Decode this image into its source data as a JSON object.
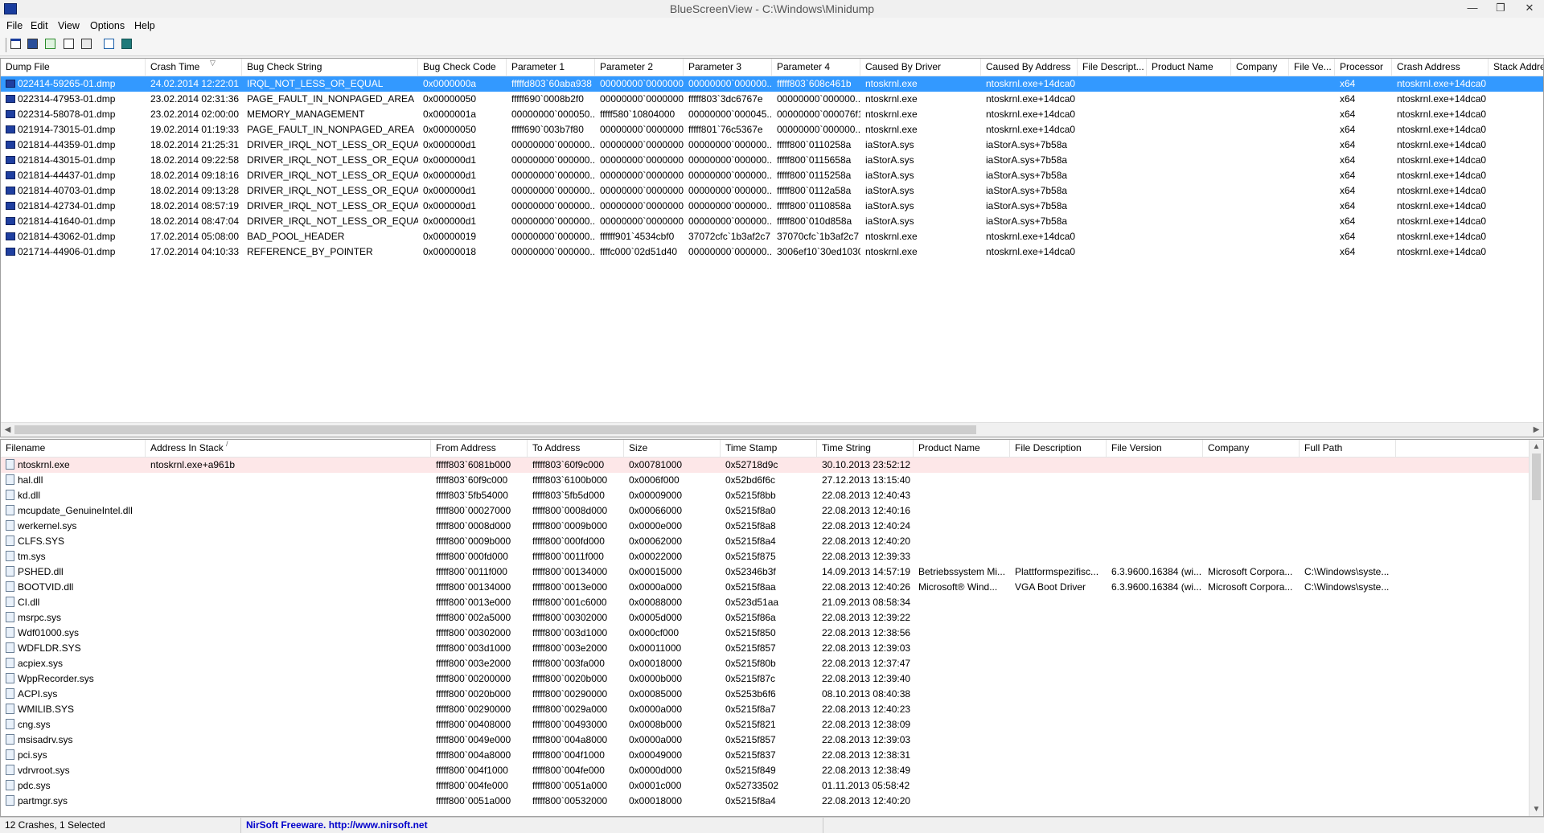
{
  "window": {
    "title": "BlueScreenView  -  C:\\Windows\\Minidump"
  },
  "window_buttons": {
    "minimize": "—",
    "restore": "❐",
    "close": "✕"
  },
  "menu": [
    "File",
    "Edit",
    "View",
    "Options",
    "Help"
  ],
  "toolbar": [
    {
      "name": "properties-icon"
    },
    {
      "name": "save-icon"
    },
    {
      "name": "refresh-icon"
    },
    {
      "name": "copy-icon"
    },
    {
      "name": "advanced-options-icon"
    },
    {
      "name": "find-icon"
    },
    {
      "name": "exit-icon"
    }
  ],
  "crash_table": {
    "columns": [
      "Dump File",
      "Crash Time",
      "Bug Check String",
      "Bug Check Code",
      "Parameter 1",
      "Parameter 2",
      "Parameter 3",
      "Parameter 4",
      "Caused By Driver",
      "Caused By Address",
      "File Descript...",
      "Product Name",
      "Company",
      "File Ve...",
      "Processor",
      "Crash Address",
      "Stack Addre"
    ],
    "sort_indicator": "▽",
    "rows": [
      [
        "022414-59265-01.dmp",
        "24.02.2014 12:22:01",
        "IRQL_NOT_LESS_OR_EQUAL",
        "0x0000000a",
        "fffffd803`60aba938",
        "00000000`0000000...",
        "00000000`000000...",
        "fffff803`608c461b",
        "ntoskrnl.exe",
        "ntoskrnl.exe+14dca0",
        "",
        "",
        "",
        "",
        "x64",
        "ntoskrnl.exe+14dca0",
        ""
      ],
      [
        "022314-47953-01.dmp",
        "23.02.2014 02:31:36",
        "PAGE_FAULT_IN_NONPAGED_AREA",
        "0x00000050",
        "fffff690`0008b2f0",
        "00000000`0000000...",
        "fffff803`3dc6767e",
        "00000000`000000...",
        "ntoskrnl.exe",
        "ntoskrnl.exe+14dca0",
        "",
        "",
        "",
        "",
        "x64",
        "ntoskrnl.exe+14dca0",
        ""
      ],
      [
        "022314-58078-01.dmp",
        "23.02.2014 02:00:00",
        "MEMORY_MANAGEMENT",
        "0x0000001a",
        "00000000`000050...",
        "fffff580`10804000",
        "00000000`000045...",
        "00000000`000076f1",
        "ntoskrnl.exe",
        "ntoskrnl.exe+14dca0",
        "",
        "",
        "",
        "",
        "x64",
        "ntoskrnl.exe+14dca0",
        ""
      ],
      [
        "021914-73015-01.dmp",
        "19.02.2014 01:19:33",
        "PAGE_FAULT_IN_NONPAGED_AREA",
        "0x00000050",
        "fffff690`003b7f80",
        "00000000`0000000...",
        "fffff801`76c5367e",
        "00000000`000000...",
        "ntoskrnl.exe",
        "ntoskrnl.exe+14dca0",
        "",
        "",
        "",
        "",
        "x64",
        "ntoskrnl.exe+14dca0",
        ""
      ],
      [
        "021814-44359-01.dmp",
        "18.02.2014 21:25:31",
        "DRIVER_IRQL_NOT_LESS_OR_EQUAL",
        "0x000000d1",
        "00000000`000000...",
        "00000000`0000000...",
        "00000000`000000...",
        "fffff800`0110258a",
        "iaStorA.sys",
        "iaStorA.sys+7b58a",
        "",
        "",
        "",
        "",
        "x64",
        "ntoskrnl.exe+14dca0",
        ""
      ],
      [
        "021814-43015-01.dmp",
        "18.02.2014 09:22:58",
        "DRIVER_IRQL_NOT_LESS_OR_EQUAL",
        "0x000000d1",
        "00000000`000000...",
        "00000000`0000000...",
        "00000000`000000...",
        "fffff800`0115658a",
        "iaStorA.sys",
        "iaStorA.sys+7b58a",
        "",
        "",
        "",
        "",
        "x64",
        "ntoskrnl.exe+14dca0",
        ""
      ],
      [
        "021814-44437-01.dmp",
        "18.02.2014 09:18:16",
        "DRIVER_IRQL_NOT_LESS_OR_EQUAL",
        "0x000000d1",
        "00000000`000000...",
        "00000000`0000000...",
        "00000000`000000...",
        "fffff800`0115258a",
        "iaStorA.sys",
        "iaStorA.sys+7b58a",
        "",
        "",
        "",
        "",
        "x64",
        "ntoskrnl.exe+14dca0",
        ""
      ],
      [
        "021814-40703-01.dmp",
        "18.02.2014 09:13:28",
        "DRIVER_IRQL_NOT_LESS_OR_EQUAL",
        "0x000000d1",
        "00000000`000000...",
        "00000000`0000000...",
        "00000000`000000...",
        "fffff800`0112a58a",
        "iaStorA.sys",
        "iaStorA.sys+7b58a",
        "",
        "",
        "",
        "",
        "x64",
        "ntoskrnl.exe+14dca0",
        ""
      ],
      [
        "021814-42734-01.dmp",
        "18.02.2014 08:57:19",
        "DRIVER_IRQL_NOT_LESS_OR_EQUAL",
        "0x000000d1",
        "00000000`000000...",
        "00000000`0000000...",
        "00000000`000000...",
        "fffff800`0110858a",
        "iaStorA.sys",
        "iaStorA.sys+7b58a",
        "",
        "",
        "",
        "",
        "x64",
        "ntoskrnl.exe+14dca0",
        ""
      ],
      [
        "021814-41640-01.dmp",
        "18.02.2014 08:47:04",
        "DRIVER_IRQL_NOT_LESS_OR_EQUAL",
        "0x000000d1",
        "00000000`000000...",
        "00000000`0000000...",
        "00000000`000000...",
        "fffff800`010d858a",
        "iaStorA.sys",
        "iaStorA.sys+7b58a",
        "",
        "",
        "",
        "",
        "x64",
        "ntoskrnl.exe+14dca0",
        ""
      ],
      [
        "021814-43062-01.dmp",
        "17.02.2014 05:08:00",
        "BAD_POOL_HEADER",
        "0x00000019",
        "00000000`000000...",
        "ffffff901`4534cbf0",
        "37072cfc`1b3af2c7",
        "37070cfc`1b3af2c7",
        "ntoskrnl.exe",
        "ntoskrnl.exe+14dca0",
        "",
        "",
        "",
        "",
        "x64",
        "ntoskrnl.exe+14dca0",
        ""
      ],
      [
        "021714-44906-01.dmp",
        "17.02.2014 04:10:33",
        "REFERENCE_BY_POINTER",
        "0x00000018",
        "00000000`000000...",
        "ffffc000`02d51d40",
        "00000000`000000...",
        "3006ef10`30ed1030",
        "ntoskrnl.exe",
        "ntoskrnl.exe+14dca0",
        "",
        "",
        "",
        "",
        "x64",
        "ntoskrnl.exe+14dca0",
        ""
      ]
    ]
  },
  "driver_table": {
    "columns": [
      "Filename",
      "Address In Stack",
      "From Address",
      "To Address",
      "Size",
      "Time Stamp",
      "Time String",
      "Product Name",
      "File Description",
      "File Version",
      "Company",
      "Full Path"
    ],
    "sort_indicator": "/",
    "rows": [
      [
        "ntoskrnl.exe",
        "ntoskrnl.exe+a961b",
        "fffff803`6081b000",
        "fffff803`60f9c000",
        "0x00781000",
        "0x52718d9c",
        "30.10.2013 23:52:12",
        "",
        "",
        "",
        "",
        ""
      ],
      [
        "hal.dll",
        "",
        "fffff803`60f9c000",
        "fffff803`6100b000",
        "0x0006f000",
        "0x52bd6f6c",
        "27.12.2013 13:15:40",
        "",
        "",
        "",
        "",
        ""
      ],
      [
        "kd.dll",
        "",
        "fffff803`5fb54000",
        "fffff803`5fb5d000",
        "0x00009000",
        "0x5215f8bb",
        "22.08.2013 12:40:43",
        "",
        "",
        "",
        "",
        ""
      ],
      [
        "mcupdate_GenuineIntel.dll",
        "",
        "fffff800`00027000",
        "fffff800`0008d000",
        "0x00066000",
        "0x5215f8a0",
        "22.08.2013 12:40:16",
        "",
        "",
        "",
        "",
        ""
      ],
      [
        "werkernel.sys",
        "",
        "fffff800`0008d000",
        "fffff800`0009b000",
        "0x0000e000",
        "0x5215f8a8",
        "22.08.2013 12:40:24",
        "",
        "",
        "",
        "",
        ""
      ],
      [
        "CLFS.SYS",
        "",
        "fffff800`0009b000",
        "fffff800`000fd000",
        "0x00062000",
        "0x5215f8a4",
        "22.08.2013 12:40:20",
        "",
        "",
        "",
        "",
        ""
      ],
      [
        "tm.sys",
        "",
        "fffff800`000fd000",
        "fffff800`0011f000",
        "0x00022000",
        "0x5215f875",
        "22.08.2013 12:39:33",
        "",
        "",
        "",
        "",
        ""
      ],
      [
        "PSHED.dll",
        "",
        "fffff800`0011f000",
        "fffff800`00134000",
        "0x00015000",
        "0x52346b3f",
        "14.09.2013 14:57:19",
        "Betriebssystem Mi...",
        "Plattformspezifisc...",
        "6.3.9600.16384 (wi...",
        "Microsoft Corpora...",
        "C:\\Windows\\syste..."
      ],
      [
        "BOOTVID.dll",
        "",
        "fffff800`00134000",
        "fffff800`0013e000",
        "0x0000a000",
        "0x5215f8aa",
        "22.08.2013 12:40:26",
        "Microsoft® Wind...",
        "VGA Boot Driver",
        "6.3.9600.16384 (wi...",
        "Microsoft Corpora...",
        "C:\\Windows\\syste..."
      ],
      [
        "CI.dll",
        "",
        "fffff800`0013e000",
        "fffff800`001c6000",
        "0x00088000",
        "0x523d51aa",
        "21.09.2013 08:58:34",
        "",
        "",
        "",
        "",
        ""
      ],
      [
        "msrpc.sys",
        "",
        "fffff800`002a5000",
        "fffff800`00302000",
        "0x0005d000",
        "0x5215f86a",
        "22.08.2013 12:39:22",
        "",
        "",
        "",
        "",
        ""
      ],
      [
        "Wdf01000.sys",
        "",
        "fffff800`00302000",
        "fffff800`003d1000",
        "0x000cf000",
        "0x5215f850",
        "22.08.2013 12:38:56",
        "",
        "",
        "",
        "",
        ""
      ],
      [
        "WDFLDR.SYS",
        "",
        "fffff800`003d1000",
        "fffff800`003e2000",
        "0x00011000",
        "0x5215f857",
        "22.08.2013 12:39:03",
        "",
        "",
        "",
        "",
        ""
      ],
      [
        "acpiex.sys",
        "",
        "fffff800`003e2000",
        "fffff800`003fa000",
        "0x00018000",
        "0x5215f80b",
        "22.08.2013 12:37:47",
        "",
        "",
        "",
        "",
        ""
      ],
      [
        "WppRecorder.sys",
        "",
        "fffff800`00200000",
        "fffff800`0020b000",
        "0x0000b000",
        "0x5215f87c",
        "22.08.2013 12:39:40",
        "",
        "",
        "",
        "",
        ""
      ],
      [
        "ACPI.sys",
        "",
        "fffff800`0020b000",
        "fffff800`00290000",
        "0x00085000",
        "0x5253b6f6",
        "08.10.2013 08:40:38",
        "",
        "",
        "",
        "",
        ""
      ],
      [
        "WMILIB.SYS",
        "",
        "fffff800`00290000",
        "fffff800`0029a000",
        "0x0000a000",
        "0x5215f8a7",
        "22.08.2013 12:40:23",
        "",
        "",
        "",
        "",
        ""
      ],
      [
        "cng.sys",
        "",
        "fffff800`00408000",
        "fffff800`00493000",
        "0x0008b000",
        "0x5215f821",
        "22.08.2013 12:38:09",
        "",
        "",
        "",
        "",
        ""
      ],
      [
        "msisadrv.sys",
        "",
        "fffff800`0049e000",
        "fffff800`004a8000",
        "0x0000a000",
        "0x5215f857",
        "22.08.2013 12:39:03",
        "",
        "",
        "",
        "",
        ""
      ],
      [
        "pci.sys",
        "",
        "fffff800`004a8000",
        "fffff800`004f1000",
        "0x00049000",
        "0x5215f837",
        "22.08.2013 12:38:31",
        "",
        "",
        "",
        "",
        ""
      ],
      [
        "vdrvroot.sys",
        "",
        "fffff800`004f1000",
        "fffff800`004fe000",
        "0x0000d000",
        "0x5215f849",
        "22.08.2013 12:38:49",
        "",
        "",
        "",
        "",
        ""
      ],
      [
        "pdc.sys",
        "",
        "fffff800`004fe000",
        "fffff800`0051a000",
        "0x0001c000",
        "0x52733502",
        "01.11.2013 05:58:42",
        "",
        "",
        "",
        "",
        ""
      ],
      [
        "partmgr.sys",
        "",
        "fffff800`0051a000",
        "fffff800`00532000",
        "0x00018000",
        "0x5215f8a4",
        "22.08.2013 12:40:20",
        "",
        "",
        "",
        "",
        ""
      ]
    ]
  },
  "status": {
    "count": "12 Crashes, 1 Selected",
    "nirsoft": "NirSoft Freeware.  http://www.nirsoft.net"
  },
  "colors": {
    "selection": "#3399ff",
    "highlight_row": "#fde7e8",
    "nirsoft_link": "#0000cc"
  }
}
